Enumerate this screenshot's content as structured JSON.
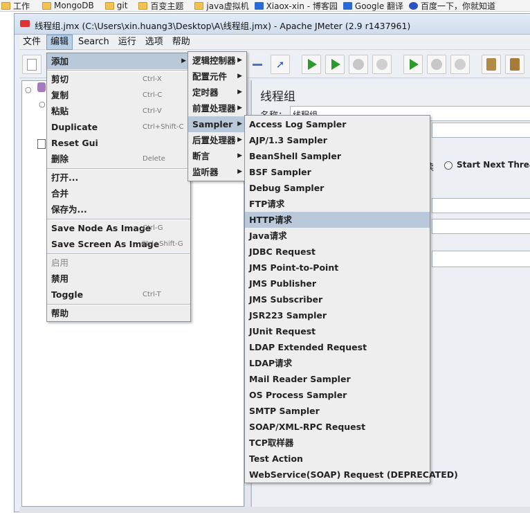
{
  "bookmarks": [
    {
      "label": "工作",
      "icon": "folder-icon"
    },
    {
      "label": "MongoDB",
      "icon": "folder-icon"
    },
    {
      "label": "git",
      "icon": "folder-icon"
    },
    {
      "label": "百变主题",
      "icon": "folder-icon"
    },
    {
      "label": "java虚拟机",
      "icon": "folder-icon"
    },
    {
      "label": "Xiaox-xin - 博客园",
      "icon": "site-icon"
    },
    {
      "label": "Google 翻译",
      "icon": "translate-icon"
    },
    {
      "label": "百度一下，你就知道",
      "icon": "paw-icon"
    }
  ],
  "window": {
    "title": "线程组.jmx (C:\\Users\\xin.huang3\\Desktop\\A\\线程组.jmx) - Apache JMeter (2.9 r1437961)"
  },
  "menubar": [
    "文件",
    "编辑",
    "Search",
    "运行",
    "选项",
    "帮助"
  ],
  "edit_menu": {
    "add": "添加",
    "cut": "剪切",
    "cut_sc": "Ctrl-X",
    "copy": "复制",
    "copy_sc": "Ctrl-C",
    "paste": "粘贴",
    "paste_sc": "Ctrl-V",
    "duplicate": "Duplicate",
    "duplicate_sc": "Ctrl+Shift-C",
    "reset_gui": "Reset Gui",
    "delete": "删除",
    "delete_sc": "Delete",
    "open": "打开...",
    "merge": "合并",
    "save_as": "保存为...",
    "save_node_image": "Save Node As Image",
    "save_node_image_sc": "Ctrl-G",
    "save_screen_image": "Save Screen As Image",
    "save_screen_image_sc": "Ctrl+Shift-G",
    "enable": "启用",
    "disable": "禁用",
    "toggle": "Toggle",
    "toggle_sc": "Ctrl-T",
    "help": "帮助"
  },
  "add_menu": [
    "逻辑控制器",
    "配置元件",
    "定时器",
    "前置处理器",
    "Sampler",
    "后置处理器",
    "断言",
    "监听器"
  ],
  "sampler_menu": [
    "Access Log Sampler",
    "AJP/1.3 Sampler",
    "BeanShell Sampler",
    "BSF Sampler",
    "Debug Sampler",
    "FTP请求",
    "HTTP请求",
    "Java请求",
    "JDBC Request",
    "JMS Point-to-Point",
    "JMS Publisher",
    "JMS Subscriber",
    "JSR223 Sampler",
    "JUnit Request",
    "LDAP Extended Request",
    "LDAP请求",
    "Mail Reader Sampler",
    "OS Process Sampler",
    "SMTP Sampler",
    "SOAP/XML-RPC Request",
    "TCP取样器",
    "Test Action",
    "WebService(SOAP) Request (DEPRECATED)"
  ],
  "sampler_selected": "HTTP请求",
  "right_panel": {
    "title": "线程组",
    "name_label": "名称：",
    "name_value": "线程组",
    "partial_label": "续",
    "radio_label": "Start Next Thread L"
  }
}
